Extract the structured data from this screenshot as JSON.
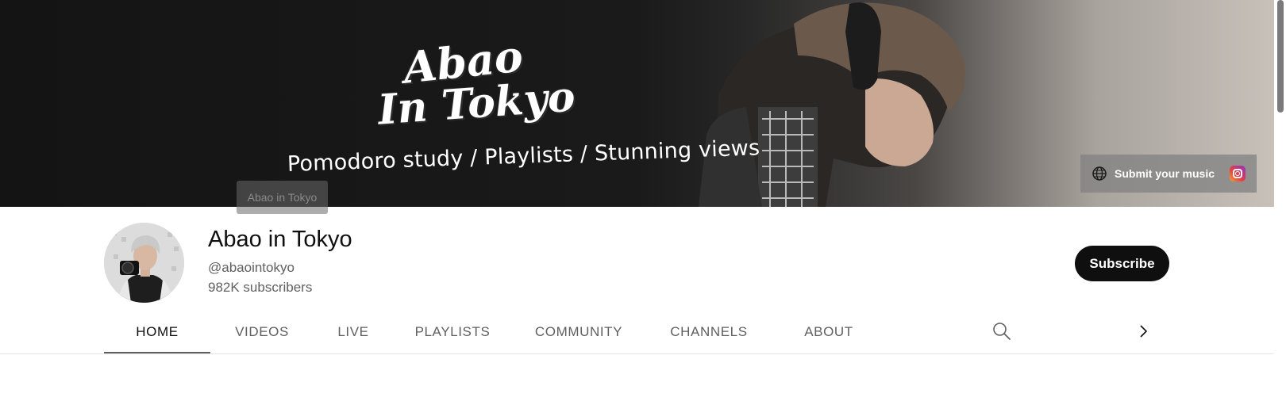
{
  "banner": {
    "logo_line1": "Abao",
    "logo_line2": "In Tokyo",
    "tagline": "Pomodoro study / Playlists / Stunning views",
    "tooltip": "Abao in Tokyo",
    "links": {
      "label": "Submit your music",
      "icons": [
        "globe-icon",
        "instagram-icon"
      ]
    }
  },
  "channel": {
    "name": "Abao in Tokyo",
    "handle": "@abaointokyo",
    "subscribers": "982K subscribers",
    "subscribe_label": "Subscribe"
  },
  "tabs": [
    {
      "label": "HOME",
      "active": true
    },
    {
      "label": "VIDEOS",
      "active": false
    },
    {
      "label": "LIVE",
      "active": false
    },
    {
      "label": "PLAYLISTS",
      "active": false
    },
    {
      "label": "COMMUNITY",
      "active": false
    },
    {
      "label": "CHANNELS",
      "active": false
    },
    {
      "label": "ABOUT",
      "active": false
    }
  ],
  "tab_icons": [
    "search-icon",
    "chevron-right-icon"
  ],
  "colors": {
    "subscribe_bg": "#0f0f0f",
    "active_tab_underline": "#606060",
    "secondary_text": "#606060"
  }
}
